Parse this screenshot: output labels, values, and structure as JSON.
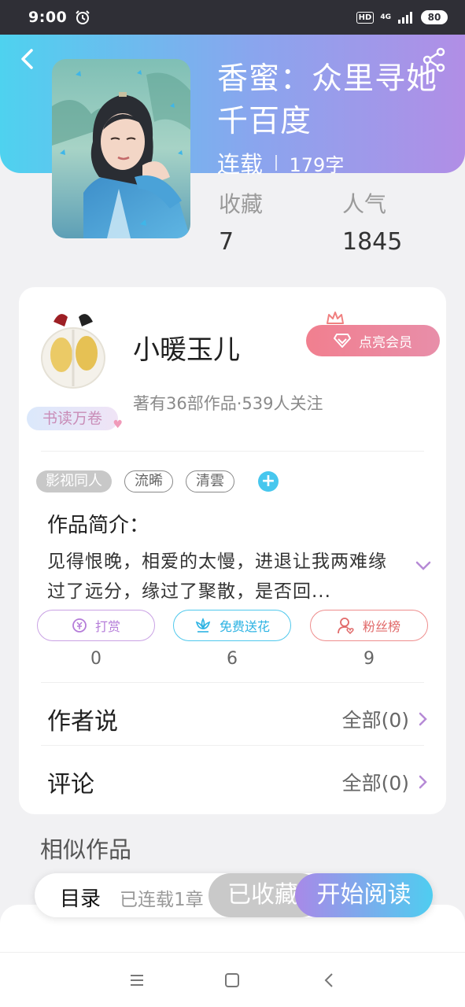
{
  "status_bar": {
    "time": "9:00",
    "icons": [
      "alarm-icon",
      "hd-icon",
      "signal-4g-icon"
    ],
    "hd": "HD",
    "network": "4G",
    "battery": "80"
  },
  "header": {
    "back_icon": "chevron-left-icon",
    "share_icon": "share-icon",
    "title": "香蜜：众里寻她千百度",
    "status": "连载",
    "word_count": "179字",
    "stats": [
      {
        "label": "收藏",
        "value": "7"
      },
      {
        "label": "人气",
        "value": "1845"
      }
    ],
    "gradient": [
      "#4ed2ef",
      "#b18ee6"
    ]
  },
  "author": {
    "name": "小暖玉儿",
    "badge": "书读万卷",
    "stats": "著有36部作品·539人关注",
    "vip_button": "点亮会员"
  },
  "tags": {
    "category": "影视同人",
    "items": [
      "流晞",
      "清雲"
    ]
  },
  "intro": {
    "heading": "作品简介：",
    "text": " 见得恨晚，相爱的太慢，进退让我两难缘过了远分，缘过了聚散，是否回..."
  },
  "actions": [
    {
      "label": "打赏",
      "count": "0",
      "icon": "coin-icon",
      "color": "#b57dd9"
    },
    {
      "label": "免费送花",
      "count": "6",
      "icon": "flower-icon",
      "color": "#2db3e3"
    },
    {
      "label": "粉丝榜",
      "count": "9",
      "icon": "fan-user-icon",
      "color": "#e16a6a"
    }
  ],
  "rows": [
    {
      "label": "作者说",
      "value": "全部(0)"
    },
    {
      "label": "评论",
      "value": "全部(0)"
    }
  ],
  "similar_title": "相似作品",
  "bottom_bar": {
    "toc_label": "目录",
    "toc_progress": "已连载1章",
    "collect_label": "已收藏",
    "read_label": "开始阅读"
  },
  "colors": {
    "accent_purple": "#a889e8",
    "accent_cyan": "#4fcdf0",
    "vip_red": "#f17f8f"
  }
}
